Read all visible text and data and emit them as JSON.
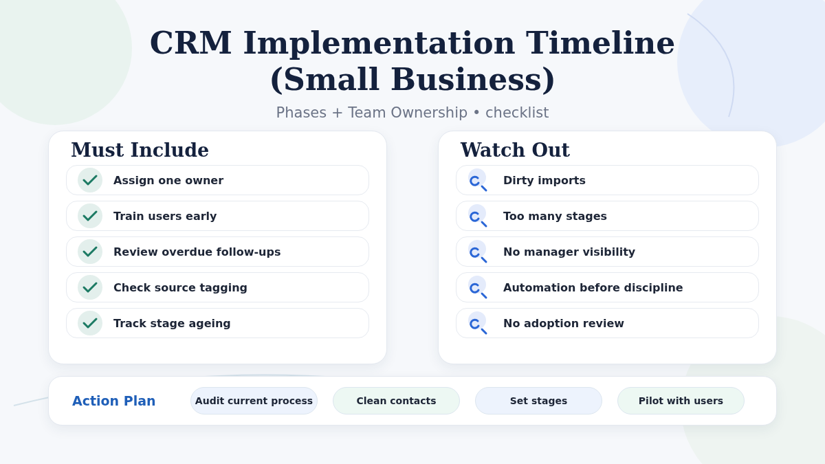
{
  "title": "CRM Implementation Timeline (Small Business)",
  "subtitle": "Phases + Team Ownership • checklist",
  "panels": [
    {
      "kind": "check",
      "heading": "Must Include",
      "items": [
        "Assign one owner",
        "Train users early",
        "Review overdue follow-ups",
        "Check source tagging",
        "Track stage ageing"
      ]
    },
    {
      "kind": "warn",
      "heading": "Watch Out",
      "items": [
        "Dirty imports",
        "Too many stages",
        "No manager visibility",
        "Automation before discipline",
        "No adoption review"
      ]
    }
  ],
  "action_plan": {
    "label": "Action Plan",
    "steps": [
      {
        "text": "Audit current process",
        "color": "#edf3fd"
      },
      {
        "text": "Clean contacts",
        "color": "#edf8f3"
      },
      {
        "text": "Set stages",
        "color": "#edf3fd"
      },
      {
        "text": "Pilot with users",
        "color": "#edf8f3"
      }
    ]
  }
}
